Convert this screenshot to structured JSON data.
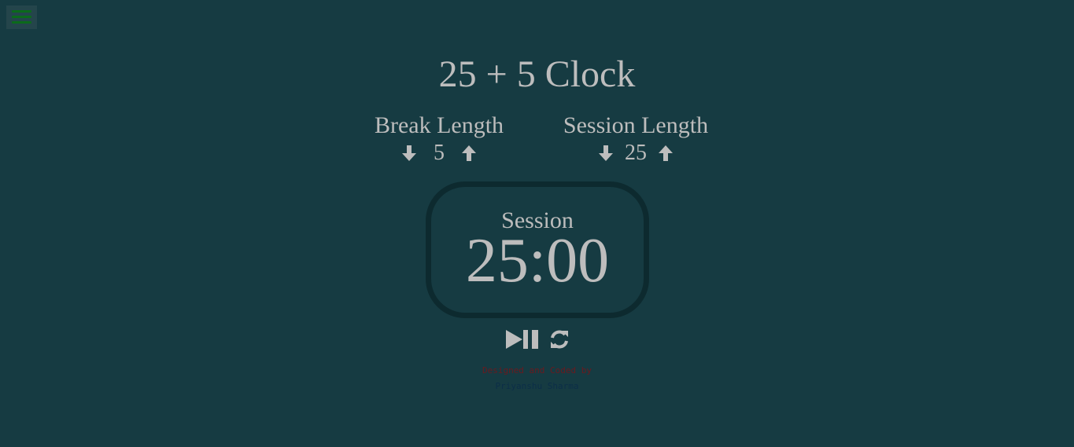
{
  "app": {
    "title": "25 + 5 Clock"
  },
  "menu": {
    "icon": "hamburger-menu-icon",
    "color": "#0b6a1b"
  },
  "break_control": {
    "label": "Break Length",
    "value": "5",
    "decrement_icon": "arrow-down-icon",
    "increment_icon": "arrow-up-icon"
  },
  "session_control": {
    "label": "Session Length",
    "value": "25",
    "decrement_icon": "arrow-down-icon",
    "increment_icon": "arrow-up-icon"
  },
  "timer": {
    "label": "Session",
    "time_left": "25:00"
  },
  "controls": {
    "play_pause_icon": "play-pause-icon",
    "reset_icon": "refresh-icon"
  },
  "credits": {
    "line1": "Designed and Coded by",
    "line2": "Priyanshu Sharma"
  },
  "colors": {
    "background": "#163b42",
    "text": "#bdbdbd",
    "timer_border": "#0d2a2f",
    "credit_line1": "#6a1a1f",
    "credit_line2": "#0c2e48"
  }
}
